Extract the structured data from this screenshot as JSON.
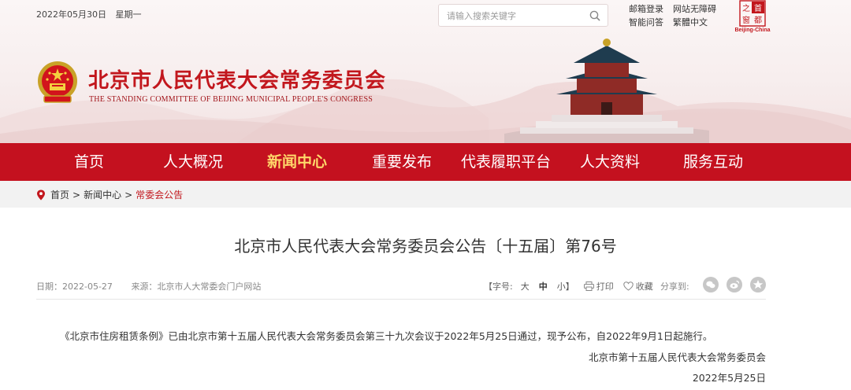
{
  "header": {
    "date": "2022年05月30日",
    "weekday": "星期一",
    "search": {
      "placeholder": "请输入搜索关键字"
    },
    "top_links": [
      "邮箱登录",
      "网站无障碍",
      "智能问答",
      "繁體中文"
    ],
    "seal": {
      "chars": [
        "首",
        "都",
        "之",
        "窗"
      ],
      "caption": "Beijing-China"
    },
    "title": "北京市人民代表大会常务委员会",
    "subtitle": "THE STANDING COMMITTEE OF BEIJING MUNICIPAL PEOPLE'S CONGRESS"
  },
  "nav": {
    "items": [
      "首页",
      "人大概况",
      "新闻中心",
      "重要发布",
      "代表履职平台",
      "人大资料",
      "服务互动"
    ],
    "active": "新闻中心"
  },
  "breadcrumb": {
    "items": [
      "首页",
      "新闻中心",
      "常委会公告"
    ],
    "separator": ">"
  },
  "article": {
    "title": "北京市人民代表大会常务委员会公告〔十五届〕第76号",
    "date_label": "日期：2022-05-27",
    "source_label": "来源：北京市人大常委会门户网站",
    "font_size_label": "【字号:",
    "size_large": "大",
    "size_mid": "中",
    "size_small": "小】",
    "print_label": "打印",
    "fav_label": "收藏",
    "share_label": "分享到:",
    "body": "《北京市住房租赁条例》已由北京市第十五届人民代表大会常务委员会第三十九次会议于2022年5月25日通过，现予公布，自2022年9月1日起施行。",
    "signature": "北京市第十五届人民代表大会常务委员会",
    "sign_date": "2022年5月25日"
  },
  "colors": {
    "brand_red": "#c4111f",
    "active_nav": "#ffd76a"
  },
  "icons": {
    "search": "search-icon",
    "pin": "location-pin-icon",
    "print": "printer-icon",
    "fav": "heart-icon",
    "share": [
      "wechat-icon",
      "weibo-icon",
      "star-icon"
    ]
  }
}
